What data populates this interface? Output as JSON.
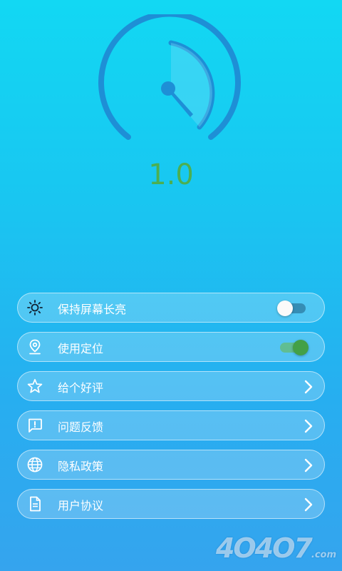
{
  "speed": {
    "value": "1.0"
  },
  "colors": {
    "accent": "#4caf50",
    "gauge": "#1e8fd6"
  },
  "menu": {
    "items": [
      {
        "label": "保持屏幕长亮",
        "icon": "sun-icon",
        "control": "toggle",
        "state": "off"
      },
      {
        "label": "使用定位",
        "icon": "location-pin-icon",
        "control": "toggle",
        "state": "on"
      },
      {
        "label": "给个好评",
        "icon": "star-icon",
        "control": "chevron"
      },
      {
        "label": "问题反馈",
        "icon": "feedback-icon",
        "control": "chevron"
      },
      {
        "label": "隐私政策",
        "icon": "globe-icon",
        "control": "chevron"
      },
      {
        "label": "用户协议",
        "icon": "document-icon",
        "control": "chevron"
      }
    ]
  },
  "watermark": {
    "text": "4O4O7",
    "suffix": ".com"
  }
}
